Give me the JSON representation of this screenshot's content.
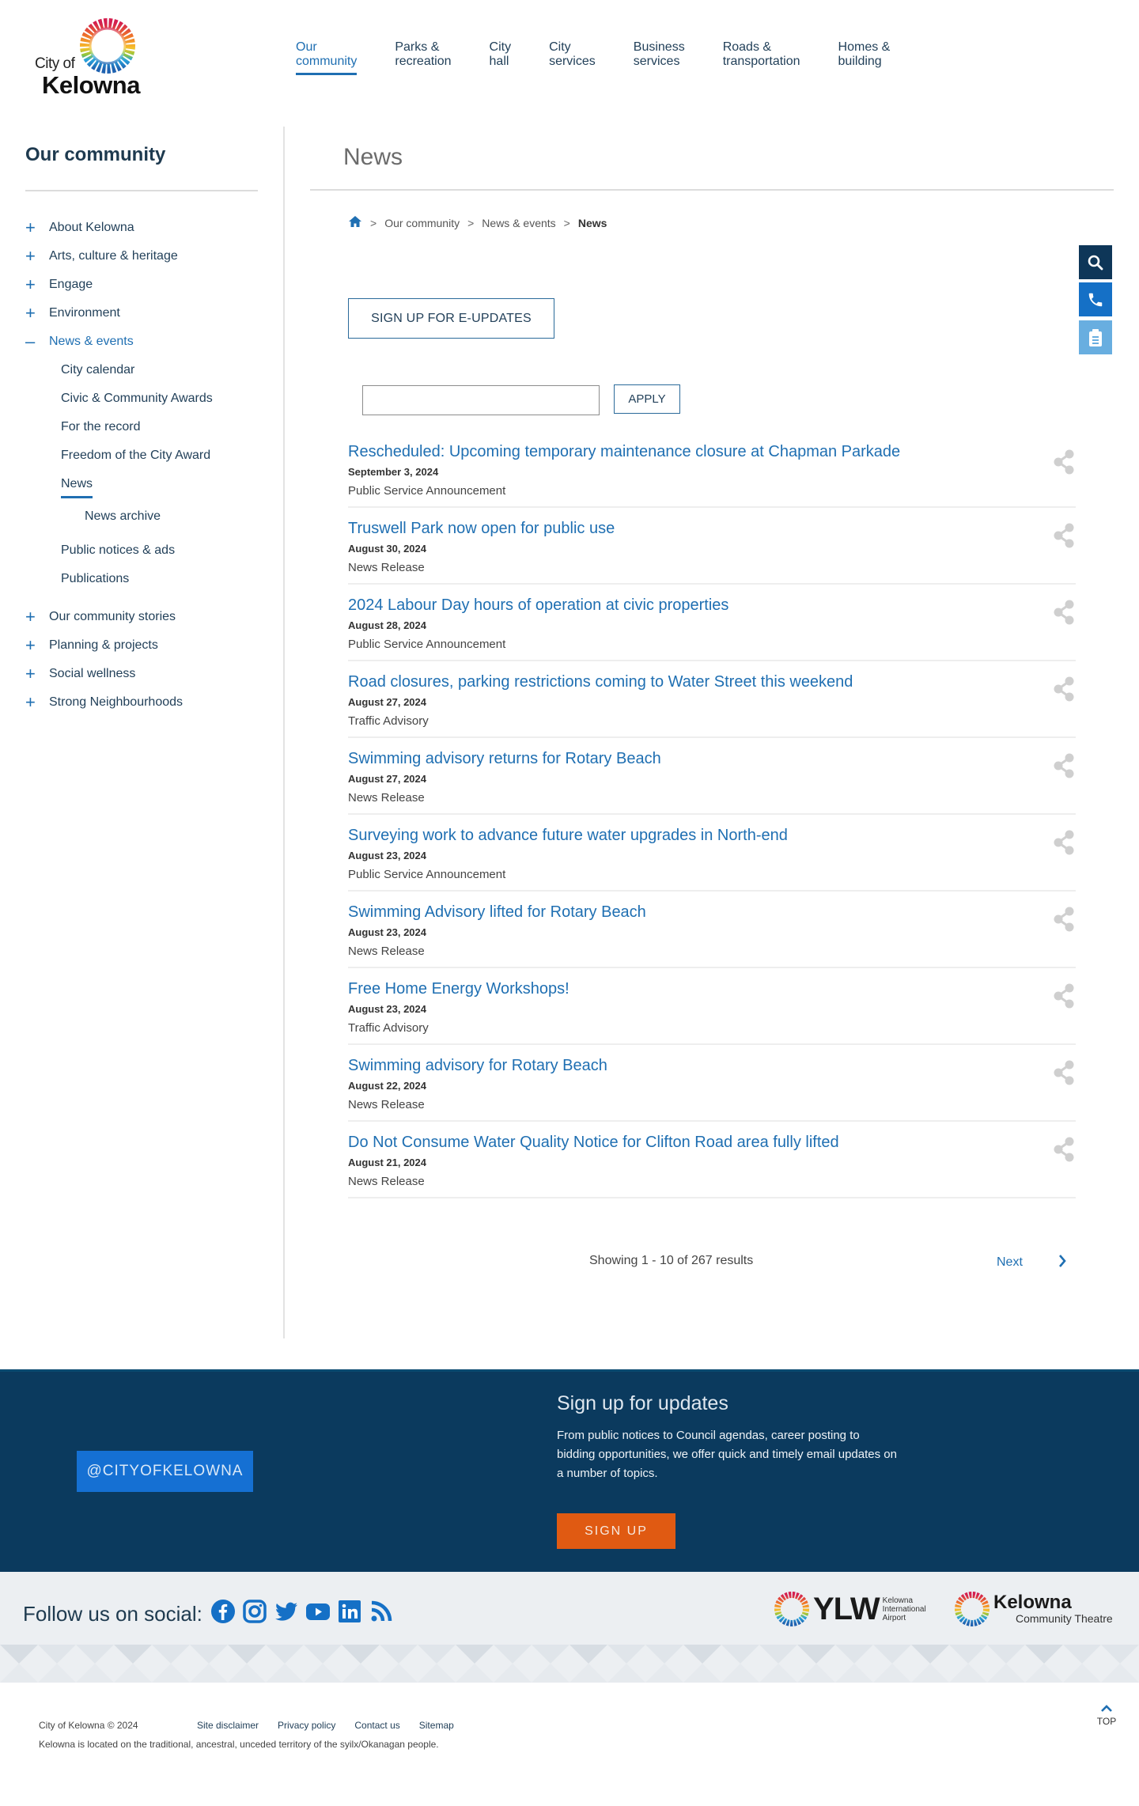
{
  "brand": {
    "logo_small": "City of",
    "logo_big": "Kelowna",
    "accent": "#1f6fb2",
    "navy": "#0b3a5e",
    "orange": "#e05a12"
  },
  "mainnav": [
    {
      "label": "Our\ncommunity",
      "active": true
    },
    {
      "label": "Parks &\nrecreation"
    },
    {
      "label": "City\nhall"
    },
    {
      "label": "City\nservices"
    },
    {
      "label": "Business\nservices"
    },
    {
      "label": "Roads &\ntransportation"
    },
    {
      "label": "Homes &\nbuilding"
    }
  ],
  "sidebar": {
    "title": "Our community",
    "items_top": [
      {
        "label": "About Kelowna",
        "icon": "plus-icon"
      },
      {
        "label": "Arts, culture & heritage",
        "icon": "plus-icon"
      },
      {
        "label": "Engage",
        "icon": "plus-icon"
      },
      {
        "label": "Environment",
        "icon": "plus-icon"
      },
      {
        "label": "News & events",
        "icon": "minus-icon",
        "open": true
      }
    ],
    "sub_items": [
      {
        "label": "City calendar"
      },
      {
        "label": "Civic & Community Awards"
      },
      {
        "label": "For the record"
      },
      {
        "label": "Freedom of the City Award"
      },
      {
        "label": "News",
        "active": true
      }
    ],
    "subsub_items": [
      {
        "label": "News archive"
      }
    ],
    "sub_items_after": [
      {
        "label": "Public notices & ads"
      },
      {
        "label": "Publications"
      }
    ],
    "items_bottom": [
      {
        "label": "Our community stories",
        "icon": "plus-icon"
      },
      {
        "label": "Planning & projects",
        "icon": "plus-icon"
      },
      {
        "label": "Social wellness",
        "icon": "plus-icon"
      },
      {
        "label": "Strong Neighbourhoods",
        "icon": "plus-icon"
      }
    ]
  },
  "main": {
    "title": "News",
    "breadcrumb": {
      "sep": ">",
      "items": [
        "Our community",
        "News & events"
      ],
      "current": "News"
    },
    "eupdates_label": "SIGN UP FOR E-UPDATES",
    "search": {
      "value": "",
      "placeholder": ""
    },
    "apply_label": "APPLY",
    "news": [
      {
        "title": "Rescheduled: Upcoming temporary maintenance closure at Chapman Parkade",
        "date": "September 3, 2024",
        "type": "Public Service Announcement"
      },
      {
        "title": "Truswell Park now open for public use",
        "date": "August 30, 2024",
        "type": "News Release"
      },
      {
        "title": "2024 Labour Day hours of operation at civic properties",
        "date": "August 28, 2024",
        "type": "Public Service Announcement"
      },
      {
        "title": "Road closures, parking restrictions coming to Water Street this weekend",
        "date": "August 27, 2024",
        "type": "Traffic Advisory"
      },
      {
        "title": "Swimming advisory returns for Rotary Beach",
        "date": "August 27, 2024",
        "type": "News Release"
      },
      {
        "title": "Surveying work to advance future water upgrades in North-end",
        "date": "August 23, 2024",
        "type": "Public Service Announcement"
      },
      {
        "title": "Swimming Advisory lifted for Rotary Beach",
        "date": "August 23, 2024",
        "type": "News Release"
      },
      {
        "title": "Free Home Energy Workshops!",
        "date": "August 23, 2024",
        "type": "Traffic Advisory"
      },
      {
        "title": "Swimming advisory for Rotary Beach",
        "date": "August 22, 2024",
        "type": "News Release"
      },
      {
        "title": "Do Not Consume Water Quality Notice for Clifton Road area fully lifted",
        "date": "August 21, 2024",
        "type": "News Release"
      }
    ],
    "results_text": "Showing 1 - 10 of 267 results",
    "next_label": "Next"
  },
  "tools": [
    "search-icon",
    "phone-icon",
    "clipboard-icon"
  ],
  "footer": {
    "handle": "@CITYOFKELOWNA",
    "signup_title": "Sign up for updates",
    "signup_text": "From public notices to Council agendas, career posting to bidding opportunities, we offer quick and timely email updates on a number of topics.",
    "signup_button": "SIGN UP",
    "follow_label": "Follow us on social:",
    "social": [
      "facebook-icon",
      "instagram-icon",
      "twitter-icon",
      "youtube-icon",
      "linkedin-icon",
      "rss-icon"
    ],
    "partners": {
      "ylw": {
        "big": "YLW",
        "sub": "Kelowna International Airport"
      },
      "kct": {
        "big": "Kelowna",
        "sub": "Community Theatre"
      }
    },
    "copyright": "City of Kelowna © 2024",
    "links": [
      "Site disclaimer",
      "Privacy policy",
      "Contact us",
      "Sitemap"
    ],
    "acknowledgement": "Kelowna is located on the traditional, ancestral, unceded territory of the syilx/Okanagan people.",
    "top_label": "TOP"
  }
}
